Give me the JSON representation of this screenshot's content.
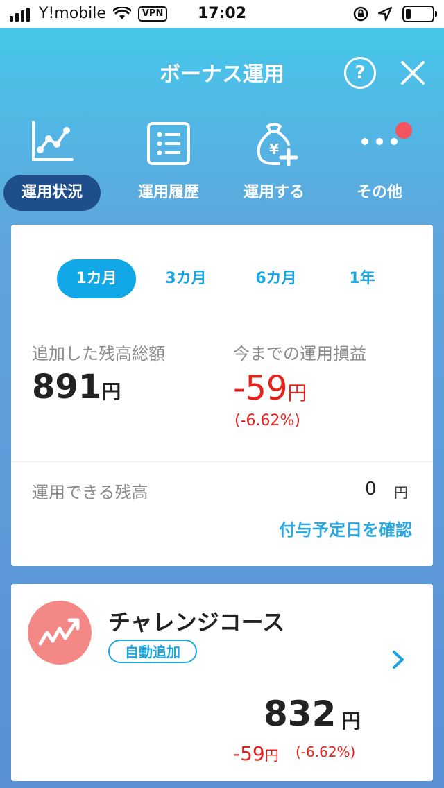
{
  "status_bar": {
    "carrier": "Y!mobile",
    "vpn": "VPN",
    "time": "17:02",
    "battery_level": 0.2
  },
  "header": {
    "title": "ボーナス運用",
    "help": "?"
  },
  "nav": {
    "items": [
      {
        "label": "運用状況",
        "icon": "chart-icon",
        "active": true
      },
      {
        "label": "運用履歴",
        "icon": "list-icon",
        "active": false
      },
      {
        "label": "運用する",
        "icon": "money-bag-yen-plus-icon",
        "active": false
      },
      {
        "label": "その他",
        "icon": "more-dots-icon",
        "active": false,
        "badge": true
      }
    ]
  },
  "summary": {
    "periods": [
      "1カ月",
      "3カ月",
      "6カ月",
      "1年"
    ],
    "selected_period": "1カ月",
    "added_total_label": "追加した残高総額",
    "added_total_value": "891",
    "yen": "円",
    "profit_label": "今までの運用損益",
    "profit_value": "-59",
    "profit_pct": "(-6.62%)",
    "available_label": "運用できる残高",
    "available_value": "0",
    "schedule_link": "付与予定日を確認"
  },
  "course": {
    "title": "チャレンジコース",
    "badge": "自動追加",
    "value": "832",
    "unit": "円",
    "gain": "-59",
    "gain_unit": "円",
    "gain_pct": "(-6.62%)"
  },
  "colors": {
    "accent": "#12a7e7",
    "negative": "#e8201c",
    "active_nav": "#1e4f8c",
    "course_icon": "#f48886",
    "badge_dot": "#f2555d"
  }
}
